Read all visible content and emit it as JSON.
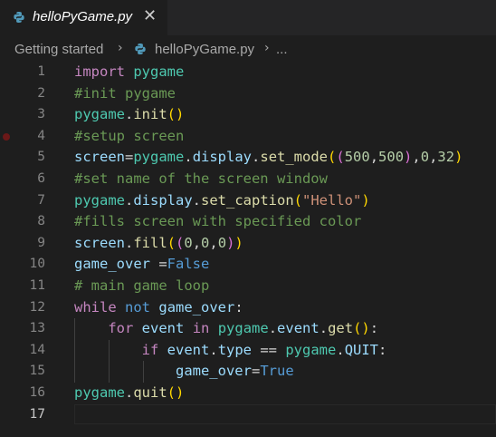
{
  "tab": {
    "title": "helloPyGame.py",
    "close_glyph": "✕",
    "icon": "python-file-icon"
  },
  "breadcrumb": {
    "items": [
      "Getting started",
      "helloPyGame.py",
      "..."
    ],
    "separator": "›"
  },
  "editor": {
    "active_line": 17,
    "breakpoint_line": 4,
    "lines": [
      {
        "n": "1",
        "tokens": [
          [
            "kw",
            "import"
          ],
          [
            "op",
            " "
          ],
          [
            "mod",
            "pygame"
          ]
        ]
      },
      {
        "n": "2",
        "tokens": [
          [
            "cm",
            "#init pygame"
          ]
        ]
      },
      {
        "n": "3",
        "tokens": [
          [
            "mod",
            "pygame"
          ],
          [
            "op",
            "."
          ],
          [
            "fn",
            "init"
          ],
          [
            "p1",
            "()"
          ]
        ]
      },
      {
        "n": "4",
        "tokens": [
          [
            "cm",
            "#setup screen"
          ]
        ]
      },
      {
        "n": "5",
        "tokens": [
          [
            "var",
            "screen"
          ],
          [
            "op",
            "="
          ],
          [
            "mod",
            "pygame"
          ],
          [
            "op",
            "."
          ],
          [
            "var",
            "display"
          ],
          [
            "op",
            "."
          ],
          [
            "fn",
            "set_mode"
          ],
          [
            "p1",
            "("
          ],
          [
            "p2",
            "("
          ],
          [
            "num",
            "500"
          ],
          [
            "op",
            ","
          ],
          [
            "num",
            "500"
          ],
          [
            "p2",
            ")"
          ],
          [
            "op",
            ","
          ],
          [
            "num",
            "0"
          ],
          [
            "op",
            ","
          ],
          [
            "num",
            "32"
          ],
          [
            "p1",
            ")"
          ]
        ]
      },
      {
        "n": "6",
        "tokens": [
          [
            "cm",
            "#set name of the screen window"
          ]
        ]
      },
      {
        "n": "7",
        "tokens": [
          [
            "mod",
            "pygame"
          ],
          [
            "op",
            "."
          ],
          [
            "var",
            "display"
          ],
          [
            "op",
            "."
          ],
          [
            "fn",
            "set_caption"
          ],
          [
            "p1",
            "("
          ],
          [
            "str",
            "\"Hello\""
          ],
          [
            "p1",
            ")"
          ]
        ]
      },
      {
        "n": "8",
        "tokens": [
          [
            "cm",
            "#fills screen with specified color"
          ]
        ]
      },
      {
        "n": "9",
        "tokens": [
          [
            "var",
            "screen"
          ],
          [
            "op",
            "."
          ],
          [
            "fn",
            "fill"
          ],
          [
            "p1",
            "("
          ],
          [
            "p2",
            "("
          ],
          [
            "num",
            "0"
          ],
          [
            "op",
            ","
          ],
          [
            "num",
            "0"
          ],
          [
            "op",
            ","
          ],
          [
            "num",
            "0"
          ],
          [
            "p2",
            ")"
          ],
          [
            "p1",
            ")"
          ]
        ]
      },
      {
        "n": "10",
        "tokens": [
          [
            "var",
            "game_over"
          ],
          [
            "op",
            " ="
          ],
          [
            "kw2",
            "False"
          ]
        ]
      },
      {
        "n": "11",
        "tokens": [
          [
            "cm",
            "# main game loop"
          ]
        ]
      },
      {
        "n": "12",
        "tokens": [
          [
            "kw",
            "while"
          ],
          [
            "op",
            " "
          ],
          [
            "kw2",
            "not"
          ],
          [
            "op",
            " "
          ],
          [
            "var",
            "game_over"
          ],
          [
            "op",
            ":"
          ]
        ]
      },
      {
        "n": "13",
        "tokens": [
          [
            "op",
            "    "
          ],
          [
            "kw",
            "for"
          ],
          [
            "op",
            " "
          ],
          [
            "var",
            "event"
          ],
          [
            "op",
            " "
          ],
          [
            "kw",
            "in"
          ],
          [
            "op",
            " "
          ],
          [
            "mod",
            "pygame"
          ],
          [
            "op",
            "."
          ],
          [
            "var",
            "event"
          ],
          [
            "op",
            "."
          ],
          [
            "fn",
            "get"
          ],
          [
            "p1",
            "()"
          ],
          [
            "op",
            ":"
          ]
        ]
      },
      {
        "n": "14",
        "tokens": [
          [
            "op",
            "        "
          ],
          [
            "kw",
            "if"
          ],
          [
            "op",
            " "
          ],
          [
            "var",
            "event"
          ],
          [
            "op",
            "."
          ],
          [
            "var",
            "type"
          ],
          [
            "op",
            " == "
          ],
          [
            "mod",
            "pygame"
          ],
          [
            "op",
            "."
          ],
          [
            "var",
            "QUIT"
          ],
          [
            "op",
            ":"
          ]
        ]
      },
      {
        "n": "15",
        "tokens": [
          [
            "op",
            "            "
          ],
          [
            "var",
            "game_over"
          ],
          [
            "op",
            "="
          ],
          [
            "kw2",
            "True"
          ]
        ]
      },
      {
        "n": "16",
        "tokens": [
          [
            "mod",
            "pygame"
          ],
          [
            "op",
            "."
          ],
          [
            "fn",
            "quit"
          ],
          [
            "p1",
            "()"
          ]
        ]
      },
      {
        "n": "17",
        "tokens": []
      }
    ]
  }
}
